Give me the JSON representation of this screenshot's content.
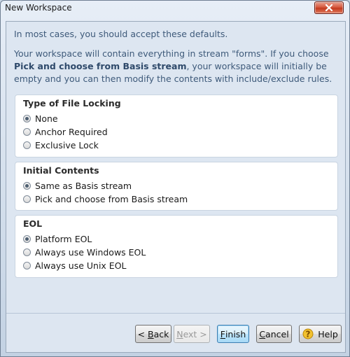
{
  "window": {
    "title": "New Workspace"
  },
  "intro": {
    "line1": "In most cases, you should accept these defaults.",
    "p2_before": "Your workspace will contain everything in stream \"forms\". If you choose ",
    "p2_bold": "Pick and choose from Basis stream",
    "p2_after": ", your workspace will initially be empty and you can then modify the contents with include/exclude rules."
  },
  "groups": [
    {
      "title": "Type of File Locking",
      "options": [
        {
          "label": "None",
          "selected": true
        },
        {
          "label": "Anchor Required",
          "selected": false
        },
        {
          "label": "Exclusive Lock",
          "selected": false
        }
      ]
    },
    {
      "title": "Initial Contents",
      "options": [
        {
          "label": "Same as Basis stream",
          "selected": true
        },
        {
          "label": "Pick and choose from Basis stream",
          "selected": false
        }
      ]
    },
    {
      "title": "EOL",
      "options": [
        {
          "label": "Platform EOL",
          "selected": true
        },
        {
          "label": "Always use Windows EOL",
          "selected": false
        },
        {
          "label": "Always use Unix EOL",
          "selected": false
        }
      ]
    }
  ],
  "buttons": {
    "back_mn": "<",
    "back_sp": " ",
    "back_u": "B",
    "back_rest": "ack",
    "next_u": "N",
    "next_rest": "ext >",
    "finish_u": "F",
    "finish_rest": "inish",
    "cancel_u": "C",
    "cancel_rest": "ancel",
    "help": "Help"
  },
  "icons": {
    "close": "close-icon",
    "help": "help-icon"
  },
  "colors": {
    "accent": "#3c7fb1",
    "close": "#c23a1f",
    "intro_text": "#3e5a7a"
  }
}
